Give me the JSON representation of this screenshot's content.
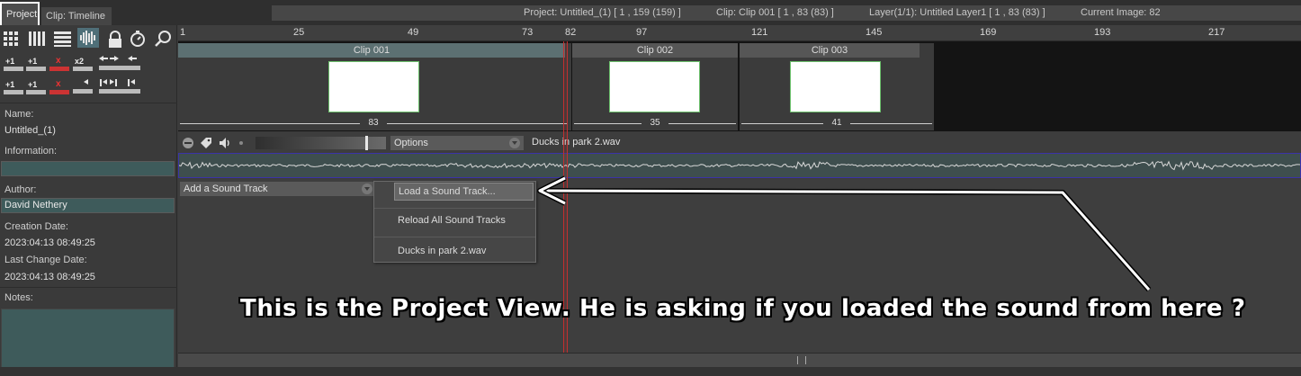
{
  "tabs": {
    "project": "Project",
    "clip_timeline": "Clip: Timeline"
  },
  "status": {
    "project": "Project: Untitled_(1) [ 1 , 159  (159) ]",
    "clip": "Clip: Clip 001 [ 1 , 83  (83) ]",
    "layer": "Layer(1/1): Untitled Layer1 [ 1 , 83  (83) ]",
    "current_image": "Current Image: 82"
  },
  "toolbar": {
    "row2": [
      "+1",
      "+1",
      "x",
      "x2"
    ],
    "row3": [
      "+1",
      "+1",
      "x"
    ]
  },
  "info": {
    "name_label": "Name:",
    "name_value": "Untitled_(1)",
    "information_label": "Information:",
    "information_value": "",
    "author_label": "Author:",
    "author_value": "David Nethery",
    "creation_label": "Creation Date:",
    "creation_value": "2023:04:13 08:49:25",
    "lastchange_label": "Last Change Date:",
    "lastchange_value": "2023:04:13 08:49:25",
    "notes_label": "Notes:",
    "notes_value": ""
  },
  "ruler": [
    "1",
    "25",
    "49",
    "73",
    "82",
    "97",
    "121",
    "145",
    "169",
    "193",
    "217"
  ],
  "clips": [
    {
      "name": "Clip 001",
      "length": "83"
    },
    {
      "name": "Clip 002",
      "length": "35"
    },
    {
      "name": "Clip 003",
      "length": "41"
    }
  ],
  "sound": {
    "options_label": "Options",
    "filename": "Ducks in park 2.wav",
    "add_track_label": "Add a Sound Track"
  },
  "menu": {
    "items": [
      "Load a Sound Track...",
      "Reload All Sound Tracks",
      "Ducks in park 2.wav"
    ]
  },
  "annotation": "This is the Project View.  He is asking if you loaded the sound from here ?",
  "colors": {
    "background": "#3c3c3c",
    "field_teal": "#3e5b5b",
    "playhead": "#c03030",
    "clip_border": "#6cc06c"
  }
}
